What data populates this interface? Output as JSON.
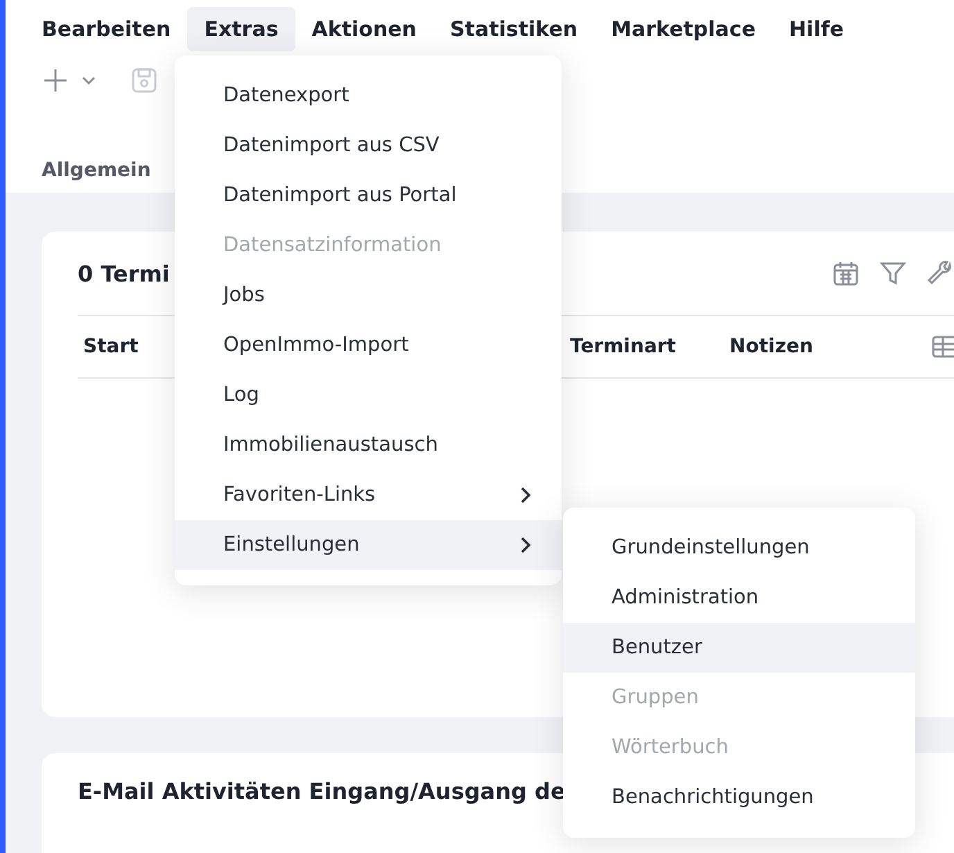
{
  "menubar": [
    {
      "label": "Bearbeiten",
      "selected": false
    },
    {
      "label": "Extras",
      "selected": true
    },
    {
      "label": "Aktionen",
      "selected": false
    },
    {
      "label": "Statistiken",
      "selected": false
    },
    {
      "label": "Marketplace",
      "selected": false
    },
    {
      "label": "Hilfe",
      "selected": false
    }
  ],
  "tabs": [
    {
      "label": "Allgemein",
      "selected": false
    }
  ],
  "cards": [
    {
      "title": "0 Termi",
      "columns": [
        "Start",
        "Terminart",
        "Notizen"
      ]
    },
    {
      "title": "E-Mail Aktivitäten Eingang/Ausgang de"
    }
  ],
  "menu": [
    {
      "label": "Datenexport",
      "disabled": false,
      "selected": false,
      "submenu": false
    },
    {
      "label": "Datenimport aus CSV",
      "disabled": false,
      "selected": false,
      "submenu": false
    },
    {
      "label": "Datenimport aus Portal",
      "disabled": false,
      "selected": false,
      "submenu": false
    },
    {
      "label": "Datensatzinformation",
      "disabled": true,
      "selected": false,
      "submenu": false
    },
    {
      "label": "Jobs",
      "disabled": false,
      "selected": false,
      "submenu": false
    },
    {
      "label": "OpenImmo-Import",
      "disabled": false,
      "selected": false,
      "submenu": false
    },
    {
      "label": "Log",
      "disabled": false,
      "selected": false,
      "submenu": false
    },
    {
      "label": "Immobilienaustausch",
      "disabled": false,
      "selected": false,
      "submenu": false
    },
    {
      "label": "Favoriten-Links",
      "disabled": false,
      "selected": false,
      "submenu": true
    },
    {
      "label": "Einstellungen",
      "disabled": false,
      "selected": true,
      "submenu": true
    }
  ],
  "submenu": [
    {
      "label": "Grundeinstellungen",
      "disabled": false,
      "selected": false
    },
    {
      "label": "Administration",
      "disabled": false,
      "selected": false
    },
    {
      "label": "Benutzer",
      "disabled": false,
      "selected": true
    },
    {
      "label": "Gruppen",
      "disabled": true,
      "selected": false
    },
    {
      "label": "Wörterbuch",
      "disabled": true,
      "selected": false
    },
    {
      "label": "Benachrichtigungen",
      "disabled": false,
      "selected": false
    }
  ]
}
